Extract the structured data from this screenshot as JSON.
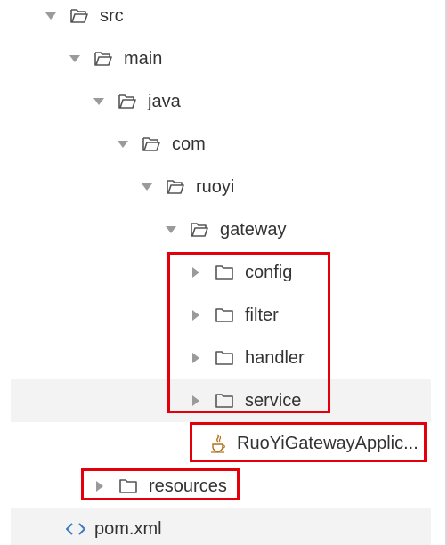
{
  "tree": [
    {
      "label": "src",
      "kind": "folder-open",
      "expanded": true
    },
    {
      "label": "main",
      "kind": "folder-open",
      "expanded": true
    },
    {
      "label": "java",
      "kind": "folder-open",
      "expanded": true
    },
    {
      "label": "com",
      "kind": "folder-open",
      "expanded": true
    },
    {
      "label": "ruoyi",
      "kind": "folder-open",
      "expanded": true
    },
    {
      "label": "gateway",
      "kind": "folder-open",
      "expanded": true
    },
    {
      "label": "config",
      "kind": "folder",
      "expanded": false
    },
    {
      "label": "filter",
      "kind": "folder",
      "expanded": false
    },
    {
      "label": "handler",
      "kind": "folder",
      "expanded": false
    },
    {
      "label": "service",
      "kind": "folder",
      "expanded": false
    },
    {
      "label": "RuoYiGatewayApplic...",
      "kind": "java-file"
    },
    {
      "label": "resources",
      "kind": "folder",
      "expanded": false
    },
    {
      "label": "pom.xml",
      "kind": "xml-file"
    }
  ],
  "colors": {
    "highlight_box": "#e3000b",
    "selected_row_bg": "#f3f3f3",
    "text": "#333333",
    "icon": "#555555",
    "arrow": "#9a9a9a",
    "java_icon": "#b07219",
    "xml_icon": "#3a78c2"
  }
}
